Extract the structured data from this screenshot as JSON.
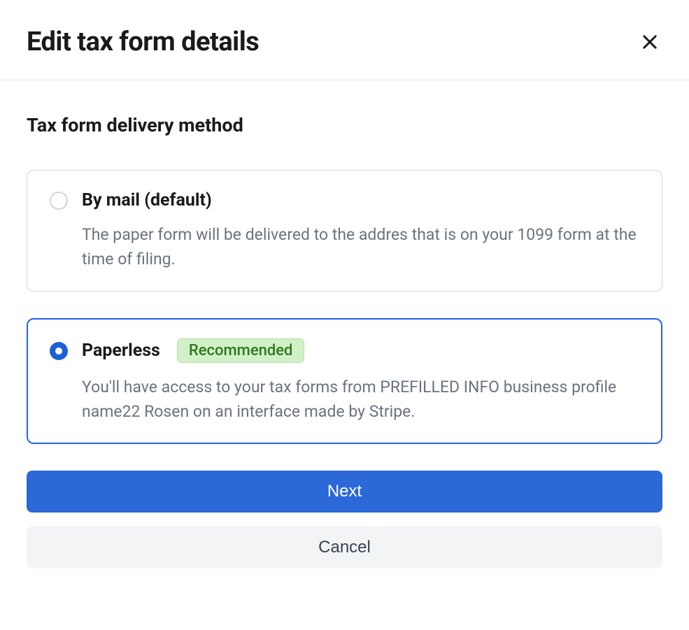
{
  "modal": {
    "title": "Edit tax form details",
    "section_title": "Tax form delivery method",
    "options": {
      "mail": {
        "label": "By mail (default)",
        "description": "The paper form will be delivered to the addres that is on your 1099 form at the time of filing.",
        "selected": false
      },
      "paperless": {
        "label": "Paperless",
        "badge": "Recommended",
        "description": "You'll have access to your tax forms from PREFILLED INFO business profile name22 Rosen on an interface made by Stripe.",
        "selected": true
      }
    },
    "buttons": {
      "next": "Next",
      "cancel": "Cancel"
    }
  }
}
